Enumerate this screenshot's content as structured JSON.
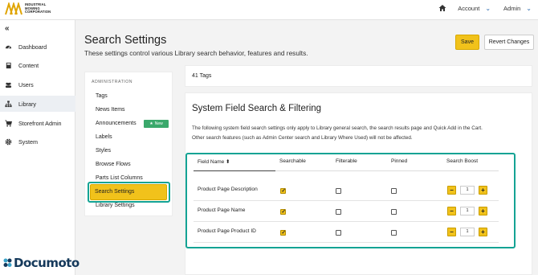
{
  "header": {
    "logo_line1": "INDUSTRIAL",
    "logo_line2": "MOWING",
    "logo_line3": "CORPORATION",
    "account_label": "Account",
    "admin_label": "Admin"
  },
  "sidebar": {
    "collapse_glyph": "«",
    "items": [
      {
        "label": "Dashboard",
        "icon": "dashboard-icon"
      },
      {
        "label": "Content",
        "icon": "book-icon"
      },
      {
        "label": "Users",
        "icon": "users-icon"
      },
      {
        "label": "Library",
        "icon": "sitemap-icon"
      },
      {
        "label": "Storefront Admin",
        "icon": "cart-icon"
      },
      {
        "label": "System",
        "icon": "gear-icon"
      }
    ],
    "active_item": "Library",
    "brand": "Documoto"
  },
  "page": {
    "title": "Search Settings",
    "subtitle": "These settings control various Library search behavior, features and results.",
    "save_label": "Save",
    "revert_label": "Revert Changes"
  },
  "admin_menu": {
    "heading": "ADMINISTRATION",
    "items": [
      "Tags",
      "News Items",
      "Announcements",
      "Labels",
      "Styles",
      "Browse Flows",
      "Parts List Columns",
      "Search Settings",
      "Library Settings"
    ],
    "active": "Search Settings",
    "new_badge": "New"
  },
  "tags_bar": {
    "label": "41 Tags"
  },
  "section": {
    "title": "System Field Search & Filtering",
    "description_line1": "The following system field search settings only apply to Library general search, the search results page and Quick Add in the Cart.",
    "description_line2": "Other search features (such as Admin Center search and Library Where Used) will not be affected."
  },
  "table": {
    "columns": [
      "Field Name",
      "Searchable",
      "Filterable",
      "Pinned",
      "Search Boost"
    ],
    "sort_glyph": "⬍",
    "rows": [
      {
        "field": "Product Page Description",
        "searchable": true,
        "filterable": false,
        "pinned": false,
        "boost": "1"
      },
      {
        "field": "Product Page Name",
        "searchable": true,
        "filterable": false,
        "pinned": false,
        "boost": "1"
      },
      {
        "field": "Product Page Product ID",
        "searchable": true,
        "filterable": false,
        "pinned": false,
        "boost": "1"
      }
    ],
    "minus_glyph": "−",
    "plus_glyph": "+"
  },
  "colors": {
    "accent_yellow": "#f1c21b",
    "highlight_teal": "#14a394",
    "badge_green": "#3aa86b",
    "brand_navy": "#15395b"
  }
}
